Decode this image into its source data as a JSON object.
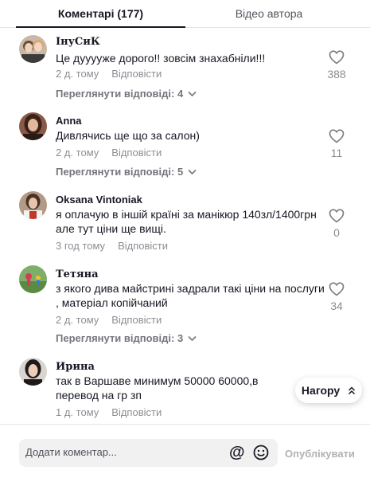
{
  "tabs": {
    "comments_label": "Коментарі (177)",
    "video_label": "Відео автора"
  },
  "comments": [
    {
      "author": "ІнуСиК",
      "text": "Це дууууже дорого!! зовсім знахабніли!!!",
      "time": "2 д. тому",
      "reply": "Відповісти",
      "likes": "388",
      "view_replies": "Переглянути відповіді: 4"
    },
    {
      "author": "Anna",
      "text": "Дивлячись ще що за салон)",
      "time": "2 д. тому",
      "reply": "Відповісти",
      "likes": "11",
      "view_replies": "Переглянути відповіді: 5"
    },
    {
      "author": "Oksana Vintoniak",
      "text": "я оплачую в іншій країні за манікюр 140зл/1400грн але тут ціни ще вищі.",
      "time": "3 год тому",
      "reply": "Відповісти",
      "likes": "0"
    },
    {
      "author": "Тетяна",
      "text": "з якого дива майстрині задрали такі ціни на послуги , матеріал копійчаний",
      "time": "2 д. тому",
      "reply": "Відповісти",
      "likes": "34",
      "view_replies": "Переглянути відповіді: 3"
    },
    {
      "author": "Ирина",
      "text": "так в Варшаве минимум 50000 60000,в перевод на гр зп",
      "time": "1 д. тому",
      "reply": "Відповісти"
    }
  ],
  "scroll_top_label": "Нагору",
  "footer": {
    "input_placeholder": "Додати коментар...",
    "mention_symbol": "@",
    "publish_label": "Опублікувати"
  },
  "icons": {
    "heart": "heart-outline-icon",
    "chevron": "chevron-down-icon",
    "scroll_top": "double-chevron-up-icon",
    "emoji": "smiley-icon",
    "mention": "at-icon"
  },
  "colors": {
    "text_primary": "#161823",
    "text_secondary": "#8a8b91",
    "input_bg": "#f1f1f2",
    "divider": "#e5e5e7"
  }
}
